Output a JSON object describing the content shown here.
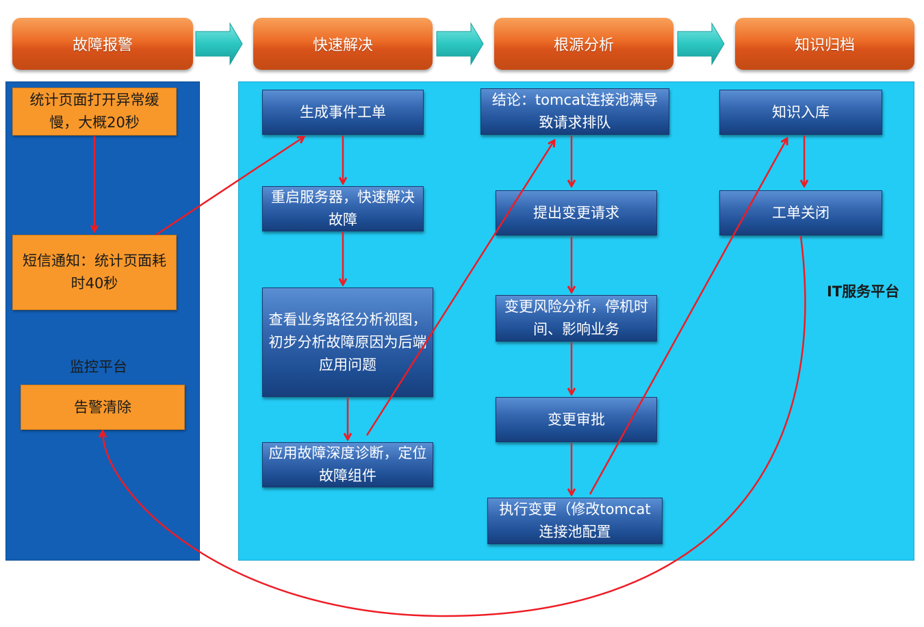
{
  "stages": [
    {
      "label": "故障报警"
    },
    {
      "label": "快速解决"
    },
    {
      "label": "根源分析"
    },
    {
      "label": "知识归档"
    }
  ],
  "monitor": {
    "platform_label": "监控平台",
    "step1": "统计页面打开异常缓慢，大概20秒",
    "step2": "短信通知：统计页面耗时40秒",
    "clear": "告警清除"
  },
  "it": {
    "platform_label": "IT服务平台",
    "resolve": [
      "生成事件工单",
      "重启服务器，快速解决故障",
      "查看业务路径分析视图，初步分析故障原因为后端应用问题",
      "应用故障深度诊断，定位故障组件"
    ],
    "rootcause": [
      "结论：tomcat连接池满导致请求排队",
      "提出变更请求",
      "变更风险分析，停机时间、影响业务",
      "变更审批",
      "执行变更（修改tomcat连接池配置"
    ],
    "archive": [
      "知识入库",
      "工单关闭"
    ]
  },
  "colors": {
    "stage": "#ec6b26",
    "monitor_bg": "#125fb5",
    "it_bg": "#23ccf5",
    "orange_box": "#f8982a",
    "blue_box": "#2a5ca3",
    "arrow_red": "#ee1c25",
    "chevron": "#2cc7c2"
  }
}
